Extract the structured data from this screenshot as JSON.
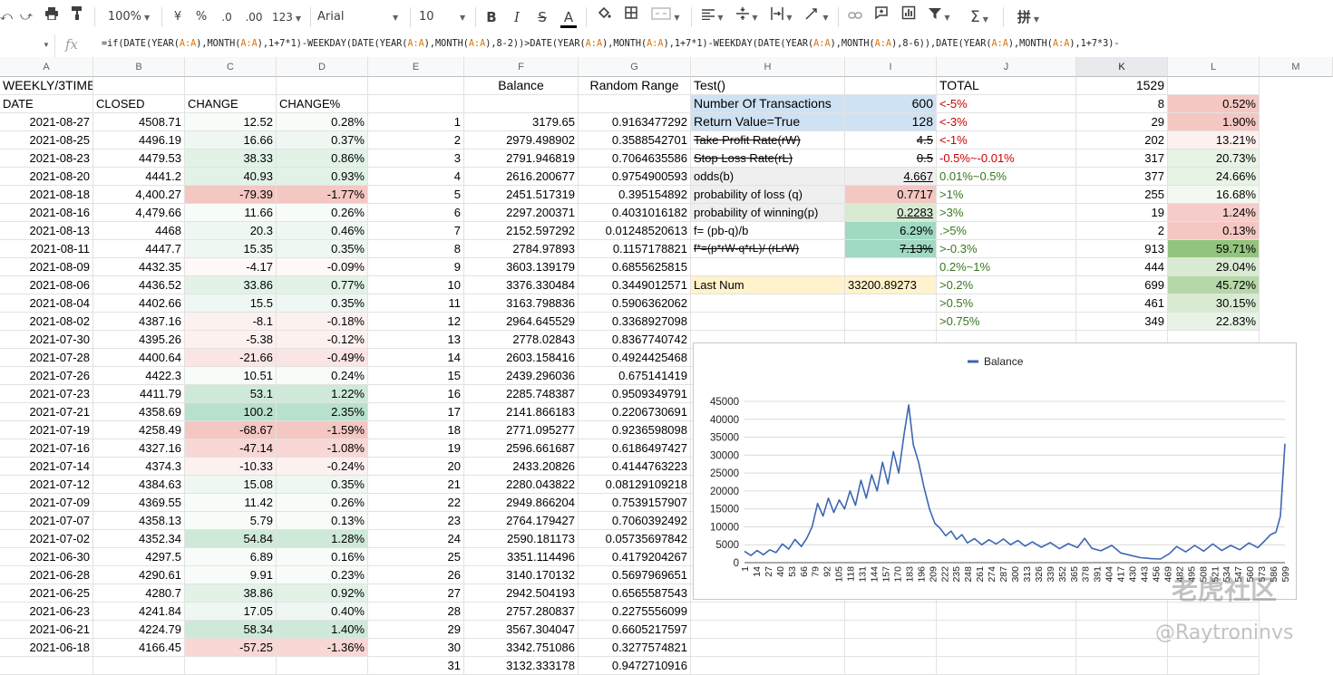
{
  "toolbar": {
    "zoom": "100%",
    "currency": "¥",
    "percent": "%",
    "dec_less": ".0",
    "dec_more": ".00",
    "format_more": "123",
    "font": "Arial",
    "font_size": "10",
    "bold": "B",
    "italic": "I",
    "strike": "S",
    "text_color": "A",
    "sigma": "Σ",
    "input_tool": "拼"
  },
  "formula_bar": {
    "fx": "fx",
    "formula_parts": [
      {
        "t": "=if(DATE(YEAR("
      },
      {
        "t": "A:A",
        "ref": true
      },
      {
        "t": "),MONTH("
      },
      {
        "t": "A:A",
        "ref": true
      },
      {
        "t": "),1+7*1)-WEEKDAY(DATE(YEAR("
      },
      {
        "t": "A:A",
        "ref": true
      },
      {
        "t": "),MONTH("
      },
      {
        "t": "A:A",
        "ref": true
      },
      {
        "t": "),8-2))>DATE(YEAR("
      },
      {
        "t": "A:A",
        "ref": true
      },
      {
        "t": "),MONTH("
      },
      {
        "t": "A:A",
        "ref": true
      },
      {
        "t": "),1+7*1)-WEEKDAY(DATE(YEAR("
      },
      {
        "t": "A:A",
        "ref": true
      },
      {
        "t": "),MONTH("
      },
      {
        "t": "A:A",
        "ref": true
      },
      {
        "t": "),8-6)),DATE(YEAR("
      },
      {
        "t": "A:A",
        "ref": true
      },
      {
        "t": "),MONTH("
      },
      {
        "t": "A:A",
        "ref": true
      },
      {
        "t": "),1+7*3)-"
      }
    ]
  },
  "columns": [
    "A",
    "B",
    "C",
    "D",
    "E",
    "F",
    "G",
    "H",
    "I",
    "J",
    "K",
    "L",
    "M"
  ],
  "header_rows": [
    [
      "WEEKLY/3TIMES",
      "",
      "",
      "",
      "",
      "Balance",
      "Random Range",
      "Test()",
      "",
      "TOTAL",
      "1529",
      ""
    ],
    [
      "DATE",
      "CLOSED",
      "CHANGE",
      "CHANGE%",
      "",
      "",
      "",
      "Number Of Transactions",
      "600",
      "<-5%",
      "8",
      "0.52%"
    ]
  ],
  "rows": [
    [
      "2021-08-27",
      "4508.71",
      "12.52",
      "0.28%",
      "1",
      "3179.65",
      "0.9163477292",
      "Return Value=True",
      "128",
      "<-3%",
      "29",
      "1.90%"
    ],
    [
      "2021-08-25",
      "4496.19",
      "16.66",
      "0.37%",
      "2",
      "2979.498902",
      "0.3588542701",
      "Take Profit Rate(rW)",
      "4.5",
      "<-1%",
      "202",
      "13.21%"
    ],
    [
      "2021-08-23",
      "4479.53",
      "38.33",
      "0.86%",
      "3",
      "2791.946819",
      "0.7064635586",
      "Stop Loss Rate(rL)",
      "0.5",
      "-0.5%~-0.01%",
      "317",
      "20.73%"
    ],
    [
      "2021-08-20",
      "4441.2",
      "40.93",
      "0.93%",
      "4",
      "2616.200677",
      "0.9754900593",
      "odds(b)",
      "4.667",
      "0.01%~0.5%",
      "377",
      "24.66%"
    ],
    [
      "2021-08-18",
      "4,400.27",
      "-79.39",
      "-1.77%",
      "5",
      "2451.517319",
      "0.395154892",
      "probability of loss (q)",
      "0.7717",
      ">1%",
      "255",
      "16.68%"
    ],
    [
      "2021-08-16",
      "4,479.66",
      "11.66",
      "0.26%",
      "6",
      "2297.200371",
      "0.4031016182",
      "probability of winning(p)",
      "0.2283",
      ">3%",
      "19",
      "1.24%"
    ],
    [
      "2021-08-13",
      "4468",
      "20.3",
      "0.46%",
      "7",
      "2152.597292",
      "0.01248520613",
      "f=  (pb-q)/b",
      "6.29%",
      ".>5%",
      "2",
      "0.13%"
    ],
    [
      "2021-08-11",
      "4447.7",
      "15.35",
      "0.35%",
      "8",
      "2784.97893",
      "0.1157178821",
      "f*=(p*rW-q*rL)/  (rLrW)",
      "7.13%",
      ">-0.3%",
      "913",
      "59.71%"
    ],
    [
      "2021-08-09",
      "4432.35",
      "-4.17",
      "-0.09%",
      "9",
      "3603.139179",
      "0.6855625815",
      "",
      "",
      "0.2%~1%",
      "444",
      "29.04%"
    ],
    [
      "2021-08-06",
      "4436.52",
      "33.86",
      "0.77%",
      "10",
      "3376.330484",
      "0.3449012571",
      "Last Num",
      "33200.89273",
      ">0.2%",
      "699",
      "45.72%"
    ],
    [
      "2021-08-04",
      "4402.66",
      "15.5",
      "0.35%",
      "11",
      "3163.798836",
      "0.5906362062",
      "",
      "",
      ">0.5%",
      "461",
      "30.15%"
    ],
    [
      "2021-08-02",
      "4387.16",
      "-8.1",
      "-0.18%",
      "12",
      "2964.645529",
      "0.3368927098",
      "",
      "",
      ">0.75%",
      "349",
      "22.83%"
    ],
    [
      "2021-07-30",
      "4395.26",
      "-5.38",
      "-0.12%",
      "13",
      "2778.02843",
      "0.8367740742",
      "",
      "",
      "",
      "",
      ""
    ],
    [
      "2021-07-28",
      "4400.64",
      "-21.66",
      "-0.49%",
      "14",
      "2603.158416",
      "0.4924425468",
      "",
      "",
      "",
      "",
      ""
    ],
    [
      "2021-07-26",
      "4422.3",
      "10.51",
      "0.24%",
      "15",
      "2439.296036",
      "0.675141419",
      "",
      "",
      "",
      "",
      ""
    ],
    [
      "2021-07-23",
      "4411.79",
      "53.1",
      "1.22%",
      "16",
      "2285.748387",
      "0.9509349791",
      "",
      "",
      "",
      "",
      ""
    ],
    [
      "2021-07-21",
      "4358.69",
      "100.2",
      "2.35%",
      "17",
      "2141.866183",
      "0.2206730691",
      "",
      "",
      "",
      "",
      ""
    ],
    [
      "2021-07-19",
      "4258.49",
      "-68.67",
      "-1.59%",
      "18",
      "2771.095277",
      "0.9236598098",
      "",
      "",
      "",
      "",
      ""
    ],
    [
      "2021-07-16",
      "4327.16",
      "-47.14",
      "-1.08%",
      "19",
      "2596.661687",
      "0.6186497427",
      "",
      "",
      "",
      "",
      ""
    ],
    [
      "2021-07-14",
      "4374.3",
      "-10.33",
      "-0.24%",
      "20",
      "2433.20826",
      "0.4144763223",
      "",
      "",
      "",
      "",
      ""
    ],
    [
      "2021-07-12",
      "4384.63",
      "15.08",
      "0.35%",
      "21",
      "2280.043822",
      "0.08129109218",
      "",
      "",
      "",
      "",
      ""
    ],
    [
      "2021-07-09",
      "4369.55",
      "11.42",
      "0.26%",
      "22",
      "2949.866204",
      "0.7539157907",
      "",
      "",
      "",
      "",
      ""
    ],
    [
      "2021-07-07",
      "4358.13",
      "5.79",
      "0.13%",
      "23",
      "2764.179427",
      "0.7060392492",
      "",
      "",
      "",
      "",
      ""
    ],
    [
      "2021-07-02",
      "4352.34",
      "54.84",
      "1.28%",
      "24",
      "2590.181173",
      "0.05735697842",
      "",
      "",
      "",
      "",
      ""
    ],
    [
      "2021-06-30",
      "4297.5",
      "6.89",
      "0.16%",
      "25",
      "3351.114496",
      "0.4179204267",
      "",
      "",
      "",
      "",
      ""
    ],
    [
      "2021-06-28",
      "4290.61",
      "9.91",
      "0.23%",
      "26",
      "3140.170132",
      "0.5697969651",
      "",
      "",
      "",
      "",
      ""
    ],
    [
      "2021-06-25",
      "4280.7",
      "38.86",
      "0.92%",
      "27",
      "2942.504193",
      "0.6565587543",
      "",
      "",
      "",
      "",
      ""
    ],
    [
      "2021-06-23",
      "4241.84",
      "17.05",
      "0.40%",
      "28",
      "2757.280837",
      "0.2275556099",
      "",
      "",
      "",
      "",
      ""
    ],
    [
      "2021-06-21",
      "4224.79",
      "58.34",
      "1.40%",
      "29",
      "3567.304047",
      "0.6605217597",
      "",
      "",
      "",
      "",
      ""
    ],
    [
      "2021-06-18",
      "4166.45",
      "-57.25",
      "-1.36%",
      "30",
      "3342.751086",
      "0.3277574821",
      "",
      "",
      "",
      "",
      ""
    ],
    [
      "",
      "",
      "",
      "",
      "31",
      "3132.333178",
      "0.9472710916",
      "",
      "",
      "",
      "",
      ""
    ]
  ],
  "chart_data": {
    "type": "line",
    "series": [
      {
        "name": "Balance"
      }
    ],
    "legend": "top-center",
    "yticks": [
      0,
      5000,
      10000,
      15000,
      20000,
      25000,
      30000,
      35000,
      40000,
      45000
    ],
    "ylim": [
      0,
      45000
    ],
    "xlim": [
      1,
      600
    ],
    "xticks": [
      "1",
      "14",
      "27",
      "40",
      "53",
      "66",
      "79",
      "92",
      "105",
      "118",
      "131",
      "144",
      "157",
      "170",
      "183",
      "196",
      "209",
      "222",
      "235",
      "248",
      "261",
      "274",
      "287",
      "300",
      "313",
      "326",
      "339",
      "352",
      "365",
      "378",
      "391",
      "404",
      "417",
      "430",
      "443",
      "456",
      "469",
      "482",
      "495",
      "508",
      "521",
      "534",
      "547",
      "560",
      "573",
      "586",
      "599"
    ],
    "points": [
      [
        1,
        3180
      ],
      [
        8,
        2000
      ],
      [
        15,
        3400
      ],
      [
        22,
        2200
      ],
      [
        29,
        3600
      ],
      [
        36,
        2800
      ],
      [
        43,
        5200
      ],
      [
        50,
        3800
      ],
      [
        57,
        6500
      ],
      [
        64,
        4500
      ],
      [
        70,
        6800
      ],
      [
        76,
        10000
      ],
      [
        82,
        16500
      ],
      [
        88,
        13000
      ],
      [
        94,
        18000
      ],
      [
        100,
        14000
      ],
      [
        106,
        17500
      ],
      [
        112,
        15000
      ],
      [
        118,
        20000
      ],
      [
        124,
        16000
      ],
      [
        130,
        23000
      ],
      [
        136,
        18000
      ],
      [
        142,
        24500
      ],
      [
        148,
        20000
      ],
      [
        154,
        28000
      ],
      [
        160,
        22000
      ],
      [
        166,
        31000
      ],
      [
        172,
        25000
      ],
      [
        178,
        36000
      ],
      [
        183,
        44000
      ],
      [
        188,
        33000
      ],
      [
        194,
        28000
      ],
      [
        200,
        21000
      ],
      [
        206,
        15000
      ],
      [
        212,
        11000
      ],
      [
        218,
        9500
      ],
      [
        224,
        7500
      ],
      [
        230,
        8800
      ],
      [
        236,
        6500
      ],
      [
        242,
        7800
      ],
      [
        248,
        5500
      ],
      [
        256,
        6700
      ],
      [
        264,
        5000
      ],
      [
        272,
        6400
      ],
      [
        280,
        5200
      ],
      [
        288,
        6600
      ],
      [
        296,
        5000
      ],
      [
        304,
        6200
      ],
      [
        312,
        4600
      ],
      [
        320,
        5800
      ],
      [
        330,
        4300
      ],
      [
        340,
        5600
      ],
      [
        350,
        3900
      ],
      [
        360,
        5300
      ],
      [
        370,
        4200
      ],
      [
        378,
        6800
      ],
      [
        386,
        4000
      ],
      [
        396,
        3300
      ],
      [
        408,
        4800
      ],
      [
        418,
        2700
      ],
      [
        428,
        2100
      ],
      [
        440,
        1400
      ],
      [
        452,
        1100
      ],
      [
        462,
        1000
      ],
      [
        472,
        2500
      ],
      [
        480,
        4500
      ],
      [
        490,
        3000
      ],
      [
        500,
        4800
      ],
      [
        510,
        3200
      ],
      [
        520,
        5200
      ],
      [
        530,
        3400
      ],
      [
        540,
        4800
      ],
      [
        550,
        3600
      ],
      [
        560,
        5500
      ],
      [
        570,
        4200
      ],
      [
        578,
        6200
      ],
      [
        584,
        7800
      ],
      [
        590,
        8500
      ],
      [
        595,
        13000
      ],
      [
        598,
        25000
      ],
      [
        600,
        33200
      ]
    ]
  },
  "watermark": {
    "cn": "老虎社区",
    "user": "@Raytroninvs"
  }
}
